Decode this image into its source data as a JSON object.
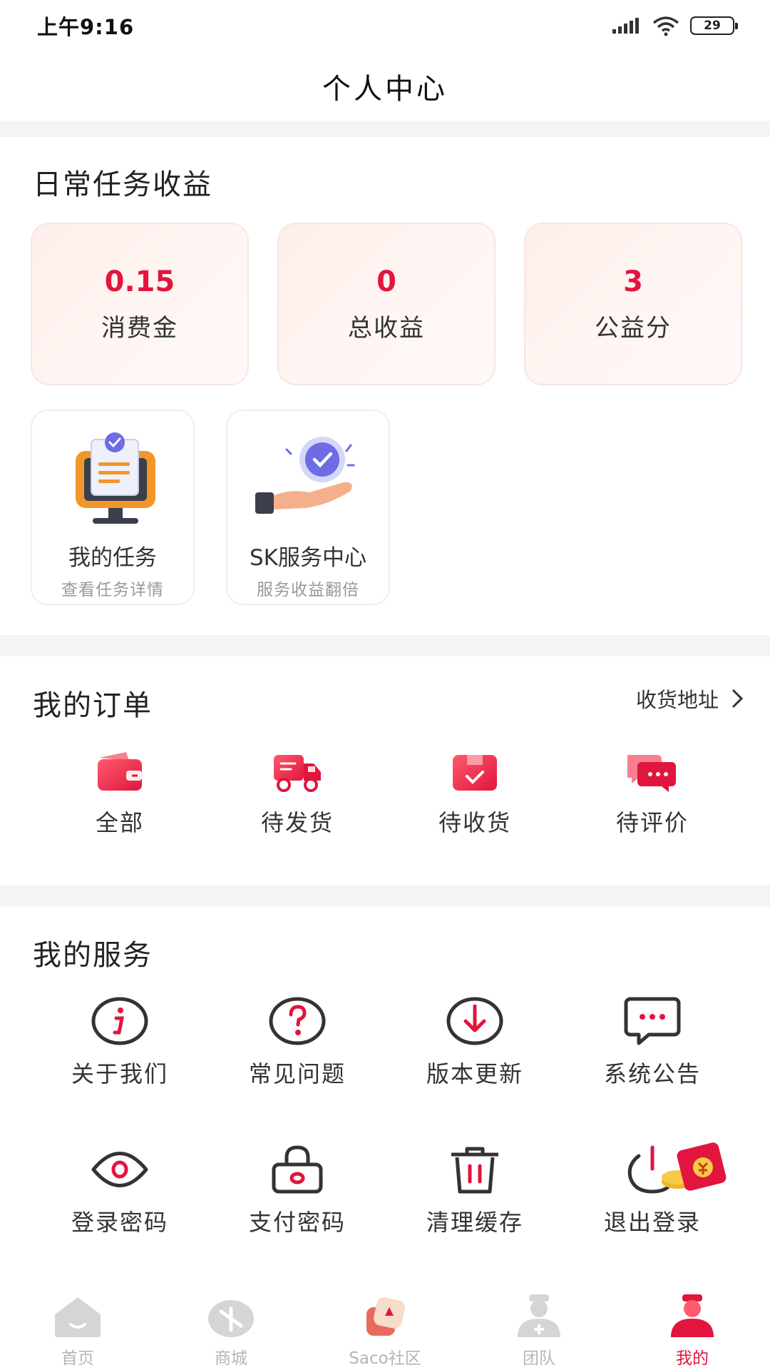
{
  "status_bar": {
    "time": "上午9:16",
    "battery": "29"
  },
  "header": {
    "title": "个人中心"
  },
  "daily": {
    "title": "日常任务收益",
    "stats": [
      {
        "value": "0.15",
        "label": "消费金"
      },
      {
        "value": "0",
        "label": "总收益"
      },
      {
        "value": "3",
        "label": "公益分"
      }
    ],
    "features": [
      {
        "title": "我的任务",
        "subtitle": "查看任务详情",
        "icon": "task-monitor-icon"
      },
      {
        "title": "SK服务中心",
        "subtitle": "服务收益翻倍",
        "icon": "service-hand-icon"
      }
    ]
  },
  "orders": {
    "title": "我的订单",
    "address_link": "收货地址",
    "items": [
      {
        "label": "全部",
        "icon": "wallet-icon"
      },
      {
        "label": "待发货",
        "icon": "truck-icon"
      },
      {
        "label": "待收货",
        "icon": "package-icon"
      },
      {
        "label": "待评价",
        "icon": "chat-bubbles-icon"
      }
    ]
  },
  "services": {
    "title": "我的服务",
    "items": [
      {
        "label": "关于我们",
        "icon": "info-icon"
      },
      {
        "label": "常见问题",
        "icon": "question-icon"
      },
      {
        "label": "版本更新",
        "icon": "download-icon"
      },
      {
        "label": "系统公告",
        "icon": "message-icon"
      },
      {
        "label": "登录密码",
        "icon": "eye-icon"
      },
      {
        "label": "支付密码",
        "icon": "lock-icon"
      },
      {
        "label": "清理缓存",
        "icon": "trash-icon"
      },
      {
        "label": "退出登录",
        "icon": "power-icon"
      }
    ]
  },
  "bottom_nav": {
    "items": [
      {
        "label": "首页",
        "icon": "home-icon"
      },
      {
        "label": "商城",
        "icon": "mall-icon"
      },
      {
        "label": "Saco社区",
        "icon": "community-icon"
      },
      {
        "label": "团队",
        "icon": "team-icon"
      },
      {
        "label": "我的",
        "icon": "profile-icon"
      }
    ],
    "active": "我的"
  },
  "colors": {
    "accent": "#e1153d",
    "icon_stroke": "#333333",
    "card_bg": "#fdeeea"
  }
}
